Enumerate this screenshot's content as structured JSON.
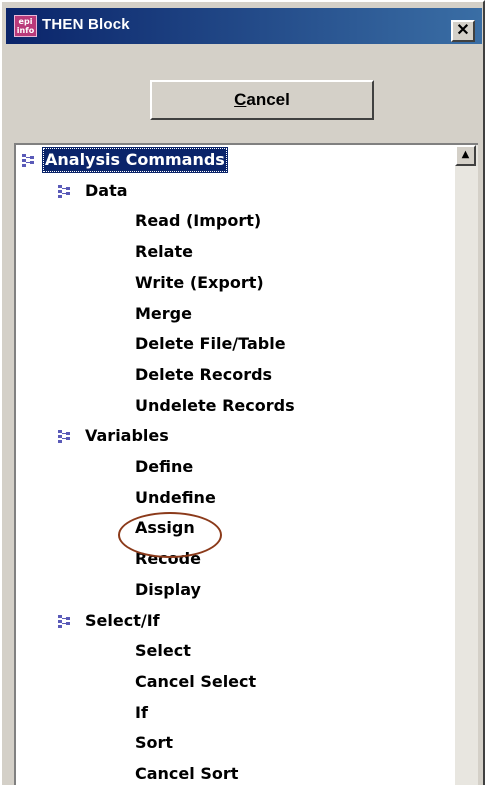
{
  "window": {
    "title": "THEN Block",
    "app_icon_text": "epi info",
    "close_glyph": "✕"
  },
  "cancel_button": {
    "label": "Cancel"
  },
  "tree": {
    "root": "Analysis Commands",
    "groups": [
      {
        "label": "Data",
        "items": [
          "Read (Import)",
          "Relate",
          "Write (Export)",
          "Merge",
          "Delete File/Table",
          "Delete Records",
          "Undelete Records"
        ]
      },
      {
        "label": "Variables",
        "items": [
          "Define",
          "Undefine",
          "Assign",
          "Recode",
          "Display"
        ]
      },
      {
        "label": "Select/If",
        "items": [
          "Select",
          "Cancel Select",
          "If",
          "Sort",
          "Cancel Sort"
        ]
      }
    ]
  },
  "scrollbar": {
    "up_glyph": "▲"
  },
  "colors": {
    "title_bar": "#0a246a",
    "annotation": "#8b3a1a"
  }
}
